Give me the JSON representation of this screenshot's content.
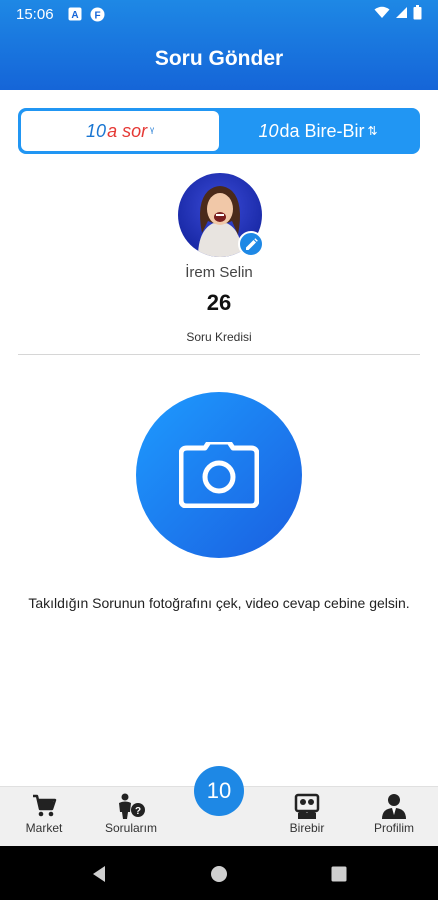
{
  "status_bar": {
    "time": "15:06",
    "left_icons": [
      "a-letter-icon",
      "f-app-icon"
    ],
    "right_icons": [
      "wifi-icon",
      "signal-icon",
      "battery-icon"
    ]
  },
  "header": {
    "title": "Soru Gönder"
  },
  "tabs": [
    {
      "num": "10",
      "text": "a sor",
      "glyph": "ᵞ",
      "active": true
    },
    {
      "num": "10",
      "text": "da Bire-Bir",
      "glyph": "⇅",
      "active": false
    }
  ],
  "profile": {
    "name": "İrem Selin",
    "credit_value": "26",
    "credit_label": "Soru Kredisi"
  },
  "camera": {
    "hint": "Takıldığın Sorunun fotoğrafını çek, video cevap cebine gelsin."
  },
  "bottom_nav": {
    "center_label": "10",
    "items": [
      {
        "label": "Market",
        "icon": "cart-icon"
      },
      {
        "label": "Sorularım",
        "icon": "person-question-icon"
      },
      {
        "label": "Birebir",
        "icon": "birebir-icon"
      },
      {
        "label": "Profilim",
        "icon": "profile-icon"
      }
    ]
  },
  "colors": {
    "primary": "#1e88e5",
    "accent_red": "#e53935",
    "camera_gradient_start": "#1e9bff",
    "camera_gradient_end": "#1a5fe0"
  }
}
